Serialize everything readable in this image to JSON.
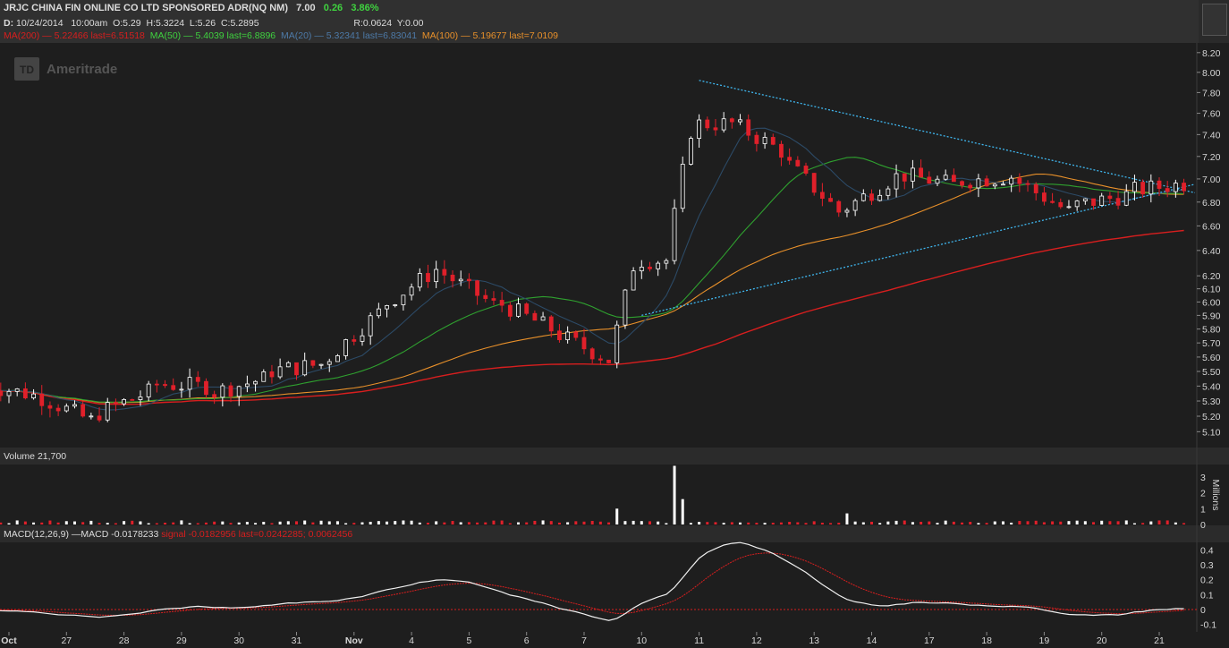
{
  "header": {
    "symbol_line": "JRJC CHINA FIN ONLINE CO LTD SPONSORED ADR(NQ NM)",
    "last": "7.00",
    "change": "0.26",
    "change_pct": "3.86%",
    "date_label": "D:",
    "date": "10/24/2014",
    "time": "10:00am",
    "open": "O:5.29",
    "high": "H:5.3224",
    "low": "L:5.26",
    "close": "C:5.2895",
    "range": "R:0.0624",
    "y": "Y:0.00"
  },
  "ma_legend": {
    "ma200": "MA(200) — 5.22466 last=6.51518",
    "ma50": "MA(50) — 5.4039 last=6.8896",
    "ma20": "MA(20) — 5.32341 last=6.83041",
    "ma100": "MA(100) — 5.19677 last=7.0109"
  },
  "volume_title": "Volume 21,700",
  "volume_unit": "Millions",
  "macd_title": {
    "base": "MACD(12,26,9) —MACD -0.0178233",
    "signal": "signal -0.0182956 last=0.0242285; 0.0062456"
  },
  "logo": "Ameritrade",
  "logo_mark": "TD",
  "colors": {
    "up": "#ffffff",
    "down": "#e0202a",
    "ma200": "#d81e1e",
    "ma100": "#e8902a",
    "ma50": "#2fa12f",
    "ma20": "#2c4a66",
    "trend": "#3fb6ee",
    "macd": "#f0f0f0",
    "signal": "#d81e1e"
  },
  "chart_data": [
    {
      "type": "candlestick",
      "title": "JRJC CHINA FIN ONLINE CO LTD SPONSORED ADR(NQ NM)",
      "interval": "intraday (hourly bars)",
      "ylim": [
        5.0,
        8.3
      ],
      "y_ticks": [
        5.1,
        5.2,
        5.3,
        5.4,
        5.5,
        5.6,
        5.7,
        5.8,
        5.9,
        6.0,
        6.1,
        6.2,
        6.4,
        6.6,
        6.8,
        7.0,
        7.2,
        7.4,
        7.6,
        7.8,
        8.0,
        8.2
      ],
      "y_tick_labels": [
        "5.10",
        "5.20",
        "5.30",
        "5.40",
        "5.50",
        "5.60",
        "5.70",
        "5.80",
        "5.90",
        "6.00",
        "6.10",
        "6.20",
        "6.40",
        "6.60",
        "6.80",
        "7.00",
        "7.20",
        "7.40",
        "7.60",
        "7.80",
        "8.00",
        "8.20"
      ],
      "y_scale": "log",
      "x_ticks": [
        "Oct",
        "27",
        "28",
        "29",
        "30",
        "31",
        "Nov",
        "4",
        "5",
        "6",
        "7",
        "10",
        "11",
        "12",
        "13",
        "14",
        "17",
        "18",
        "19",
        "20",
        "21"
      ],
      "close_by_session": [
        5.34,
        5.17,
        5.36,
        5.4,
        5.45,
        5.55,
        5.92,
        6.25,
        5.98,
        5.8,
        5.58,
        6.32,
        7.5,
        7.25,
        6.72,
        7.02,
        6.95,
        7.02,
        6.72,
        6.86,
        6.96
      ],
      "moving_averages": [
        {
          "name": "MA(200)",
          "last": 6.51518
        },
        {
          "name": "MA(50)",
          "last": 6.8896
        },
        {
          "name": "MA(20)",
          "last": 6.83041
        },
        {
          "name": "MA(100)",
          "last": 7.0109
        }
      ],
      "trendlines": [
        {
          "from": [
            "11",
            7.92
          ],
          "to": [
            "21",
            6.95
          ]
        },
        {
          "from": [
            "10",
            5.9
          ],
          "to": [
            "21",
            6.88
          ]
        }
      ],
      "legend": "top-left"
    },
    {
      "type": "bar",
      "title": "Volume 21,700",
      "ylabel": "Millions",
      "ylim": [
        0,
        3.5
      ],
      "y_ticks": [
        0,
        1,
        2,
        3
      ],
      "spikes": [
        {
          "session": "11",
          "value": 3.7
        },
        {
          "session": "11",
          "value": 1.6
        },
        {
          "session": "10",
          "value": 1.0
        },
        {
          "session": "14",
          "value": 0.7
        }
      ]
    },
    {
      "type": "line",
      "title": "MACD(12,26,9)",
      "ylim": [
        -0.15,
        0.45
      ],
      "y_ticks": [
        0.4,
        0.3,
        0.2,
        0.1,
        0,
        -0.1
      ],
      "y_tick_labels": [
        "0.4",
        "0.3",
        "0.2",
        "0.1",
        "0",
        "-0.1"
      ],
      "series": [
        {
          "name": "MACD",
          "last": -0.0178233
        },
        {
          "name": "signal",
          "last": 0.0242285
        }
      ]
    }
  ]
}
